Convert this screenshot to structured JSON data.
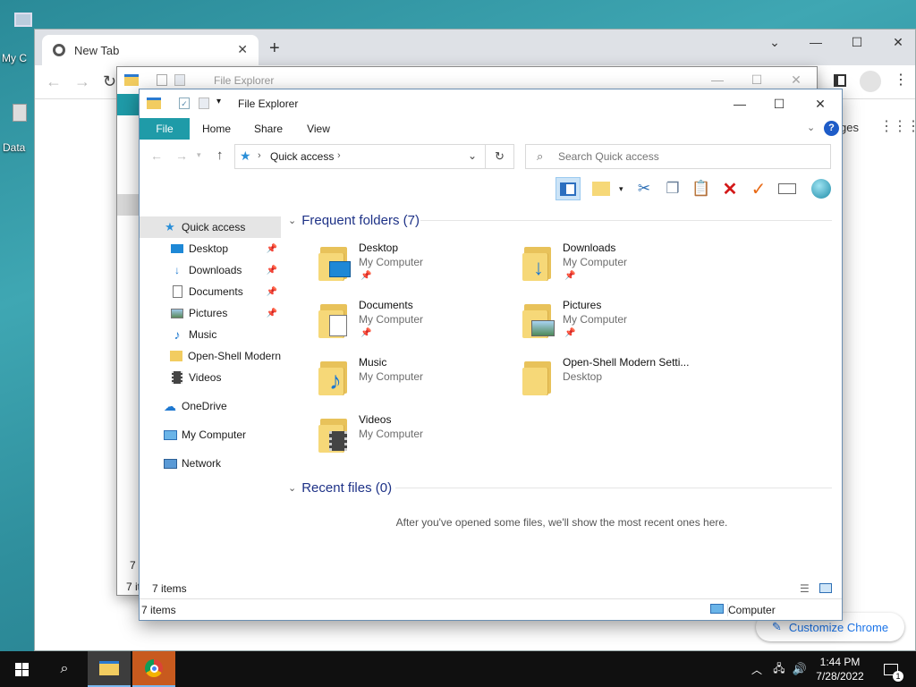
{
  "desktop": {
    "icon1_label": "My C",
    "icon2_label": "Data"
  },
  "chrome": {
    "tab_title": "New Tab",
    "new_tab": "+",
    "omnibox_partial": "ges",
    "customize_label": "Customize Chrome"
  },
  "explorer_back": {
    "title": "File Explorer",
    "status_items": "7 ite",
    "side_partial": "7 i"
  },
  "explorer": {
    "title": "File Explorer",
    "ribbon_tabs": [
      "File",
      "Home",
      "Share",
      "View"
    ],
    "address_path": "Quick access",
    "search_placeholder": "Search Quick access",
    "nav": [
      {
        "label": "Quick access",
        "icon": "star-icon"
      },
      {
        "label": "Desktop",
        "icon": "desktop-icon",
        "pinned": true
      },
      {
        "label": "Downloads",
        "icon": "download-arrow-icon",
        "pinned": true
      },
      {
        "label": "Documents",
        "icon": "document-icon",
        "pinned": true
      },
      {
        "label": "Pictures",
        "icon": "picture-icon",
        "pinned": true
      },
      {
        "label": "Music",
        "icon": "music-note-icon"
      },
      {
        "label": "Open-Shell Modern",
        "icon": "folder-icon"
      },
      {
        "label": "Videos",
        "icon": "film-icon"
      },
      {
        "label": "OneDrive",
        "icon": "cloud-icon"
      },
      {
        "label": "My Computer",
        "icon": "computer-icon"
      },
      {
        "label": "Network",
        "icon": "network-icon"
      }
    ],
    "frequent_header": "Frequent folders (7)",
    "folders": [
      {
        "name": "Desktop",
        "location": "My Computer",
        "pinned": true
      },
      {
        "name": "Downloads",
        "location": "My Computer",
        "pinned": true
      },
      {
        "name": "Documents",
        "location": "My Computer",
        "pinned": true
      },
      {
        "name": "Pictures",
        "location": "My Computer",
        "pinned": true
      },
      {
        "name": "Music",
        "location": "My Computer",
        "pinned": false
      },
      {
        "name": "Open-Shell Modern Setti...",
        "location": "Desktop",
        "pinned": false
      },
      {
        "name": "Videos",
        "location": "My Computer",
        "pinned": false
      }
    ],
    "recent_header": "Recent files (0)",
    "recent_empty": "After you've opened some files, we'll show the most recent ones here.",
    "status_items": "7 items",
    "bottom_status_items": "7 items",
    "bottom_status_computer": "Computer"
  },
  "taskbar": {
    "time": "1:44 PM",
    "date": "7/28/2022",
    "notification_count": "1"
  }
}
